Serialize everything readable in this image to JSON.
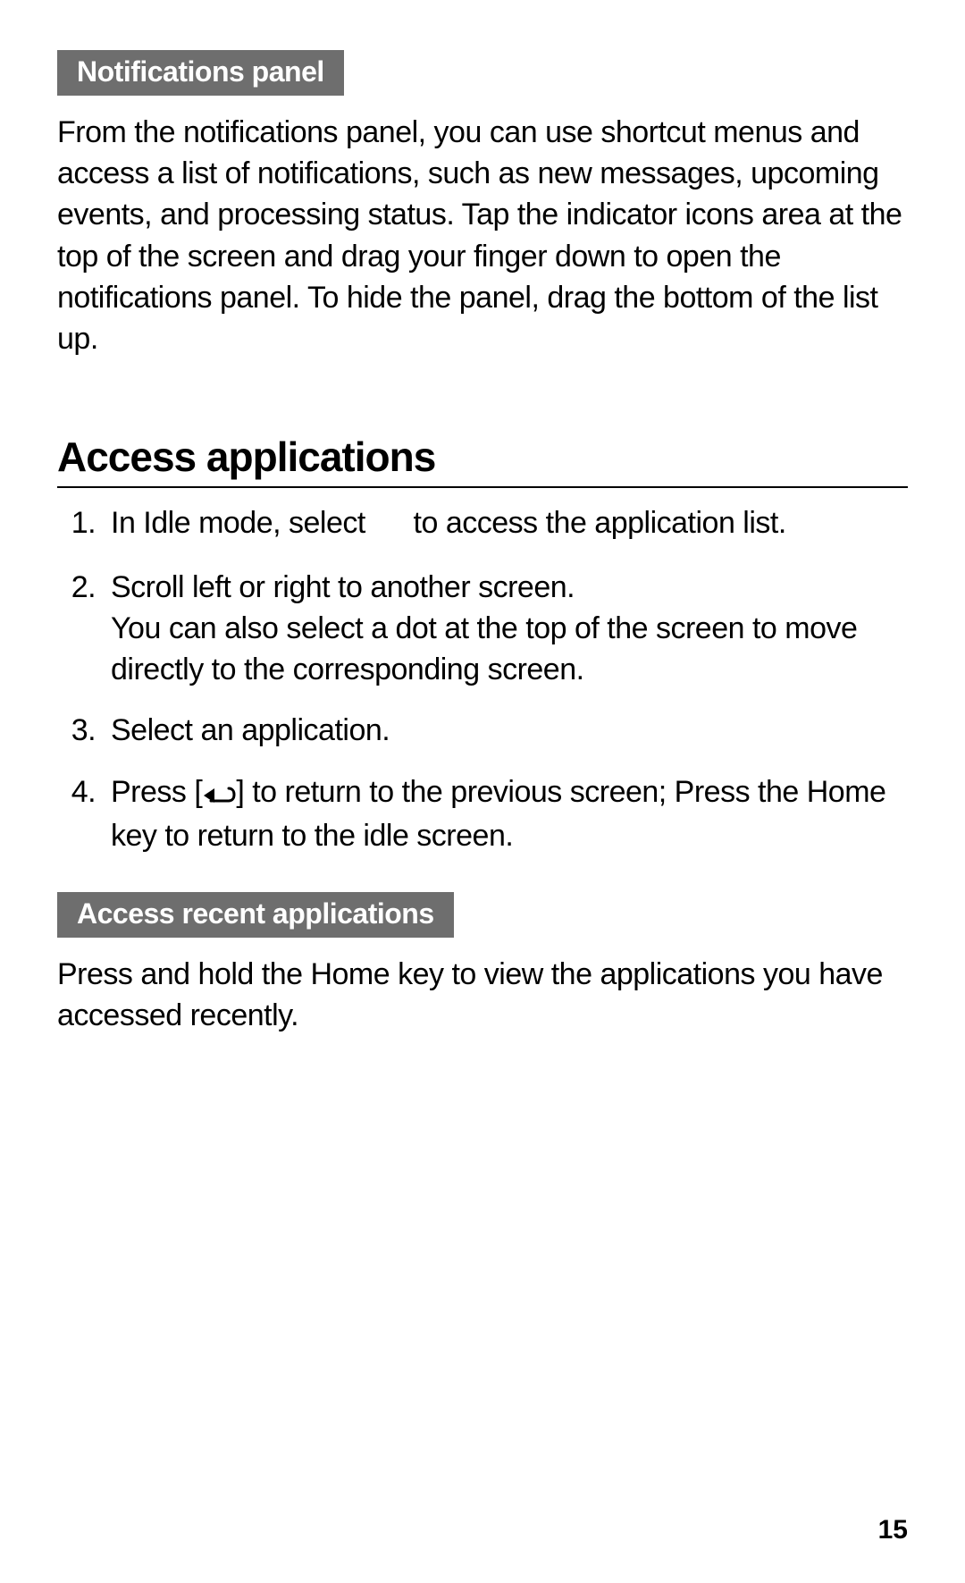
{
  "section1": {
    "tag": "Notifications panel",
    "body": "From the notifications panel, you can use shortcut menus and access a list of notifications, such as new messages, upcoming events, and processing status. Tap the indicator icons area at the top of the screen and drag your finger down to open the notifications panel. To hide the panel, drag the bottom of the list up."
  },
  "heading": "Access applications",
  "steps": {
    "s1a": "In Idle mode, select ",
    "s1b": " to access the application list.",
    "s2a": "Scroll left or right to another screen.",
    "s2b": "You can also select a dot at the top of the screen to move directly to the corresponding screen.",
    "s3": "Select an application.",
    "s4a": "Press [",
    "s4b": "] to return to the previous screen; Press the Home key to return to the idle screen."
  },
  "section2": {
    "tag": "Access recent applications",
    "body": "Press and hold the Home key to view the applications you have accessed recently."
  },
  "page_number": "15"
}
